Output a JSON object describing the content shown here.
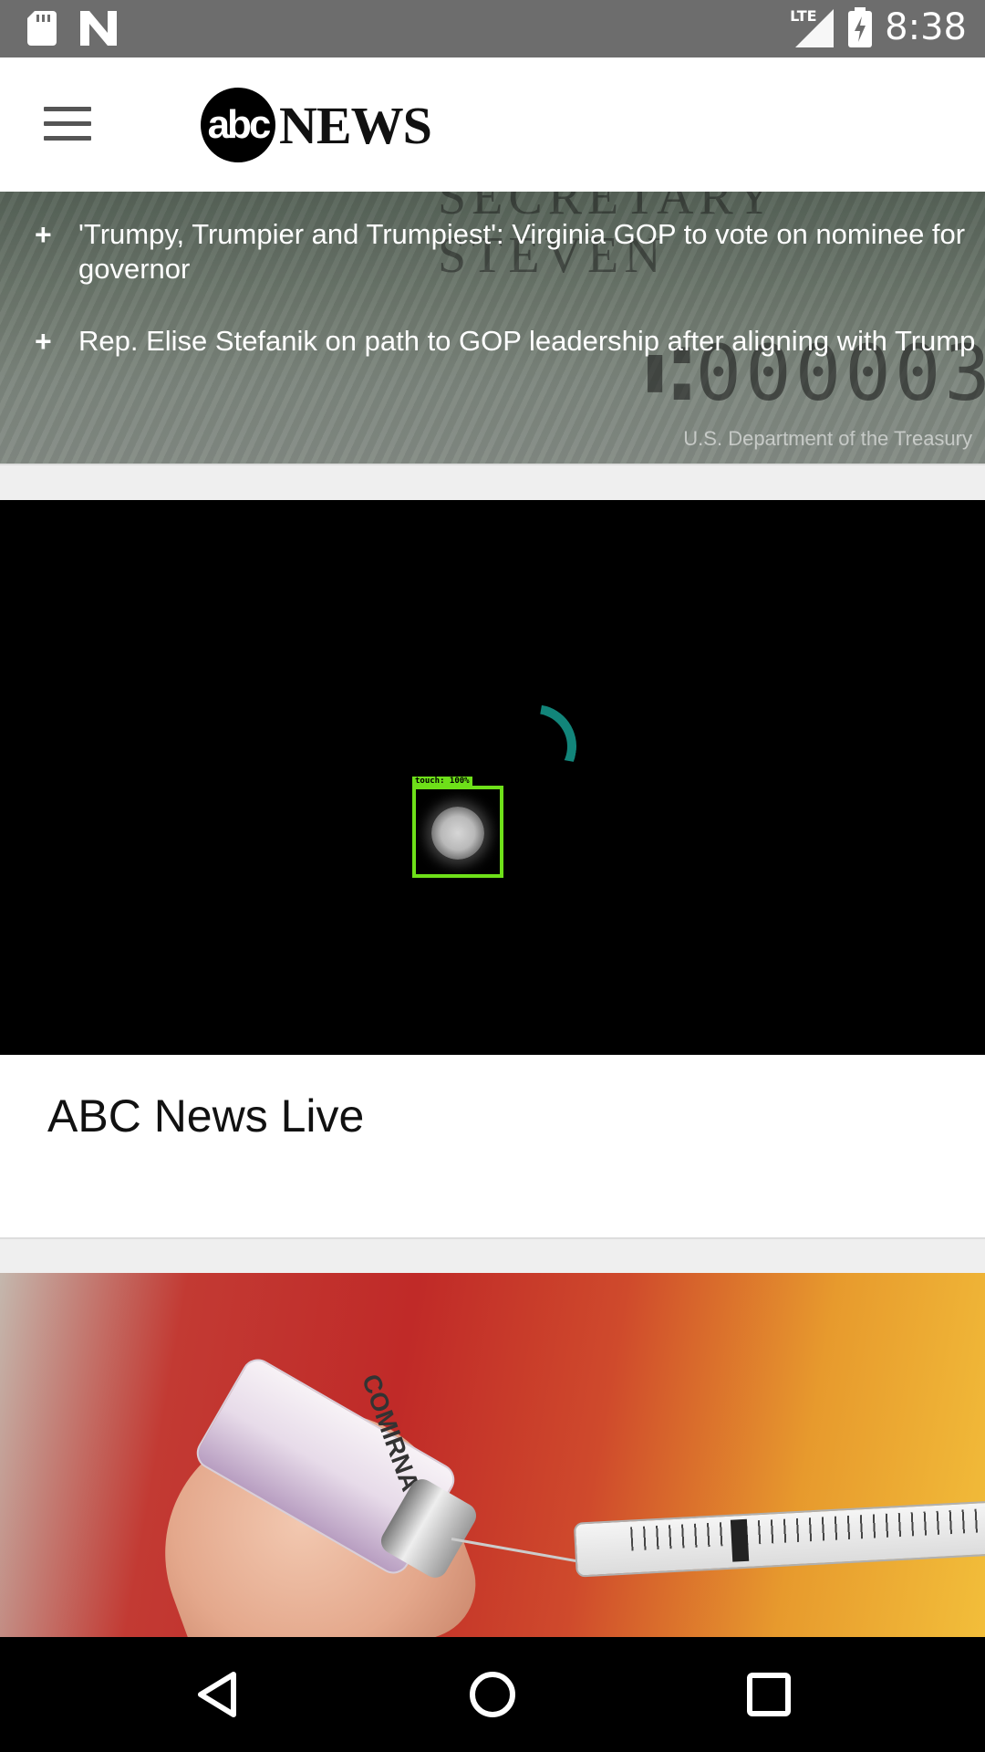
{
  "status_bar": {
    "time": "8:38",
    "network": "LTE",
    "icons": [
      "sd-card-icon",
      "n-notification-icon",
      "lte-signal-icon",
      "battery-charging-icon"
    ]
  },
  "app_bar": {
    "logo_circle_text": "abc",
    "logo_word": "NEWS",
    "menu_icon": "hamburger-menu-icon"
  },
  "hero": {
    "related": [
      {
        "text": "'Trumpy, Trumpier and Trumpiest': Virginia GOP to vote on nominee for governor"
      },
      {
        "text": "Rep. Elise Stefanik on path to GOP leadership after aligning with Trump"
      }
    ],
    "expand_symbol": "+",
    "photo_credit": "U.S. Department of the Treasury"
  },
  "video": {
    "touch_label": "touch: 100%",
    "accent": "#12857a",
    "touch_box_color": "#6ee019"
  },
  "live_card": {
    "title": "ABC News Live"
  },
  "vaccine_image": {
    "vial_label": "COMIRNATY"
  },
  "nav_bar": {
    "back": "back-icon",
    "home": "home-icon",
    "recents": "recents-icon"
  }
}
